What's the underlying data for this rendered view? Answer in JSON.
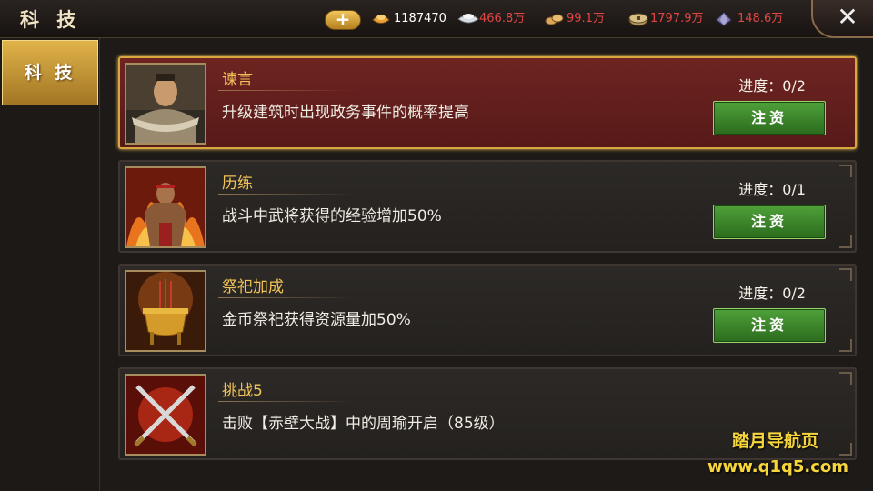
{
  "header": {
    "title": "科 技",
    "plus_label": "+",
    "close_label": "✕",
    "resources": [
      {
        "name": "gold-ingot-icon",
        "value": "1187470",
        "color": "#ffffff"
      },
      {
        "name": "silver-icon",
        "value": "466.8万",
        "color": "#e24545"
      },
      {
        "name": "food-icon",
        "value": "99.1万",
        "color": "#e24545"
      },
      {
        "name": "coin-icon",
        "value": "1797.9万",
        "color": "#e24545"
      },
      {
        "name": "crystal-icon",
        "value": "148.6万",
        "color": "#e24545"
      }
    ]
  },
  "sidebar": {
    "tabs": [
      {
        "label": "科 技",
        "active": true
      }
    ]
  },
  "techs": [
    {
      "name": "谏言",
      "desc": "升级建筑时出现政务事件的概率提高",
      "progress": "进度：0/2",
      "button": "注资",
      "selected": true,
      "portrait": "advisor-portrait-icon"
    },
    {
      "name": "历练",
      "desc": "战斗中武将获得的经验增加50%",
      "progress": "进度：0/1",
      "button": "注资",
      "selected": false,
      "portrait": "warrior-portrait-icon"
    },
    {
      "name": "祭祀加成",
      "desc": "金币祭祀获得资源量加50%",
      "progress": "进度：0/2",
      "button": "注资",
      "selected": false,
      "portrait": "incense-burner-icon"
    },
    {
      "name": "挑战5",
      "desc": "击败【赤壁大战】中的周瑜开启（85级）",
      "progress": "",
      "button": "",
      "selected": false,
      "portrait": "crossed-swords-icon"
    }
  ],
  "watermark": {
    "line1": "踏月导航页",
    "line2": "www.q1q5.com"
  },
  "colors": {
    "accent_gold": "#f1c35a",
    "selected_bg": "#6e2421",
    "button_green": "#3d8a2c",
    "resource_red": "#e24545"
  }
}
